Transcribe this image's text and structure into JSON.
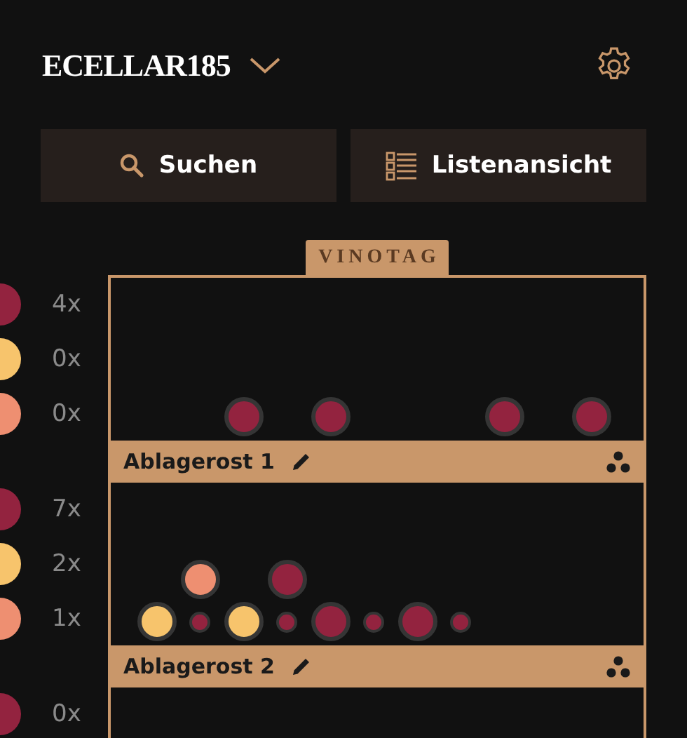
{
  "header": {
    "title": "ECELLAR185"
  },
  "actions": [
    {
      "kind": "search",
      "label": "Suchen"
    },
    {
      "kind": "list",
      "label": "Listenansicht"
    }
  ],
  "brand": "VINOTAG",
  "shelves": [
    {
      "name": "Ablagerost 1",
      "counts": [
        {
          "color": "#93233f",
          "count": "4x"
        },
        {
          "color": "#f7c46c",
          "count": "0x"
        },
        {
          "color": "#ee8f71",
          "count": "0x"
        }
      ],
      "rows": [
        [
          {
            "kind": "empty"
          },
          {
            "kind": "empty"
          },
          {
            "kind": "bottle",
            "color": "#93233f"
          },
          {
            "kind": "empty"
          },
          {
            "kind": "bottle",
            "color": "#93233f"
          },
          {
            "kind": "empty"
          },
          {
            "kind": "empty"
          },
          {
            "kind": "empty"
          },
          {
            "kind": "bottle",
            "color": "#93233f"
          },
          {
            "kind": "empty"
          },
          {
            "kind": "bottle",
            "color": "#93233f"
          }
        ]
      ]
    },
    {
      "name": "Ablagerost 2",
      "counts": [
        {
          "color": "#93233f",
          "count": "7x"
        },
        {
          "color": "#f7c46c",
          "count": "2x"
        },
        {
          "color": "#ee8f71",
          "count": "1x"
        }
      ],
      "rows": [
        [
          {
            "kind": "empty"
          },
          {
            "kind": "bottle",
            "color": "#ee8f71"
          },
          {
            "kind": "empty"
          },
          {
            "kind": "bottle",
            "color": "#93233f"
          }
        ],
        [
          {
            "kind": "bottle",
            "color": "#f7c46c"
          },
          {
            "kind": "neck",
            "color": "#93233f"
          },
          {
            "kind": "bottle",
            "color": "#f7c46c"
          },
          {
            "kind": "neck",
            "color": "#93233f"
          },
          {
            "kind": "bottle",
            "color": "#93233f"
          },
          {
            "kind": "neck",
            "color": "#93233f"
          },
          {
            "kind": "bottle",
            "color": "#93233f"
          },
          {
            "kind": "neck",
            "color": "#93233f"
          }
        ]
      ]
    },
    {
      "counts": [
        {
          "color": "#93233f",
          "count": "0x"
        }
      ]
    }
  ]
}
